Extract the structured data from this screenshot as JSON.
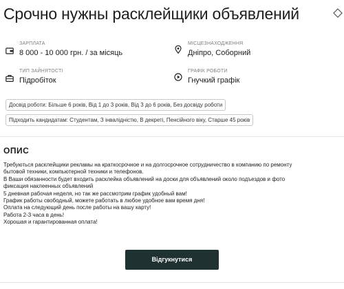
{
  "job": {
    "title": "Срочно нужны расклейщики объявлений"
  },
  "info": {
    "salary": {
      "label": "ЗАРПЛАТА",
      "value": "8 000 - 10 000 грн. / за місяць",
      "icon": "wallet-icon"
    },
    "location": {
      "label": "МІСЦЕЗНАХОДЖЕННЯ",
      "value": "Дніпро, Соборний",
      "icon": "location-pin-icon"
    },
    "employment": {
      "label": "ТИП ЗАЙНЯТОСТІ",
      "value": "Підробіток",
      "icon": "briefcase-icon"
    },
    "schedule": {
      "label": "ГРАФІК РОБОТИ",
      "value": "Гнучкий графік",
      "icon": "play-circle-icon"
    }
  },
  "tags": {
    "experience": "Досвід роботи: Більше 6 років, Від 1 до 3 років, Від 3 до 6 років, Без досвіду роботи",
    "candidates": "Підходить кандидатам: Студентам, З інвалідністю, В декреті, Пенсійного віку, Старше 45 років"
  },
  "description": {
    "heading": "ОПИС",
    "lines": [
      "Требуються расклейщики рекламы на краткосрочное и на долгосрочное сотрудничество в компанию по ремонту",
      "бытовой техники, компьютерной техники и телефонов.",
      "В Ваши обязанности будет входить расклейка объявлений на доски для объявлений около подъездов и фото",
      "фиксация наклеенных объявлений",
      "5 дневная рабочая неделя, но так же рассмотрим график удобный вам!",
      "График работы свободный, можете работать в любое удобное вам время дня!",
      "Оплата на следующий день после работы на вашу карту!",
      "Работа 2-3 часа в день!",
      "Хорошая и гарантированная оплата!"
    ]
  },
  "actions": {
    "apply_label": "Відгукнутися",
    "favorite_icon": "diamond-heart-icon"
  },
  "colors": {
    "button_bg": "#203131",
    "text": "#1c1c1c",
    "muted": "#7d7d7d"
  }
}
